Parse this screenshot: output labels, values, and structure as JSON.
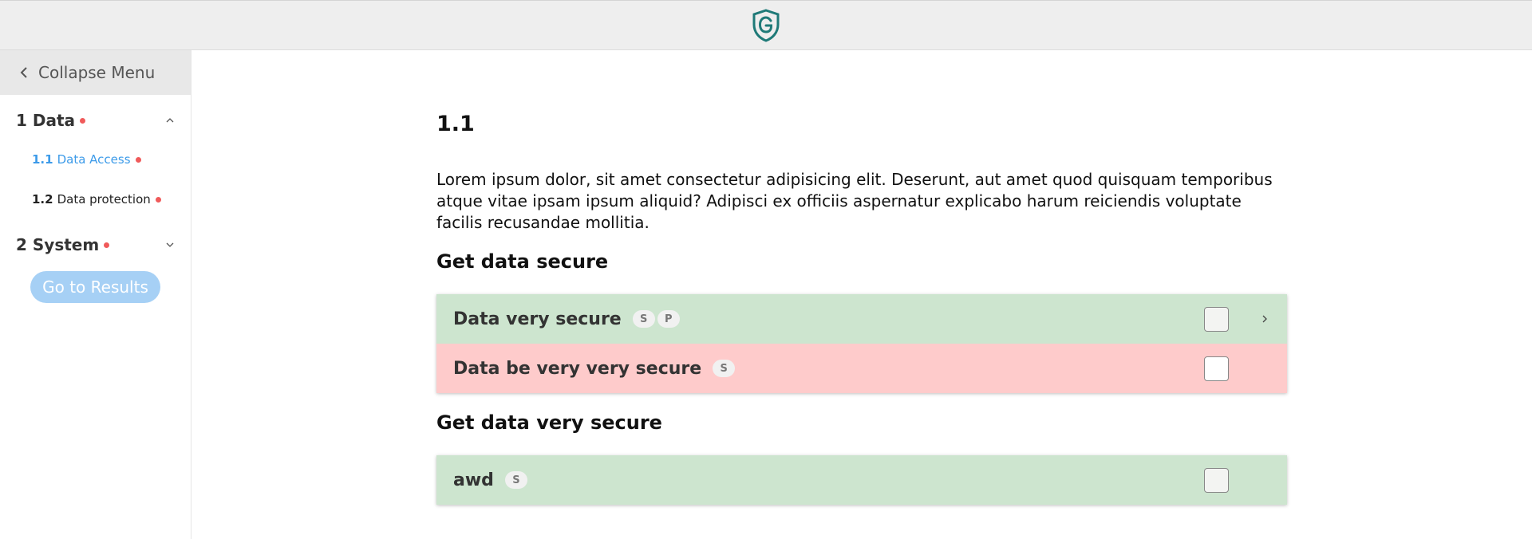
{
  "header": {
    "logo_icon": "shield-g-logo",
    "logo_color": "#1f7a78"
  },
  "sidebar": {
    "collapse_label": "Collapse Menu",
    "sections": [
      {
        "title": "1 Data",
        "expanded": true,
        "items": [
          {
            "num": "1.1",
            "label": "Data Access",
            "active": true
          },
          {
            "num": "1.2",
            "label": "Data protection",
            "active": false
          }
        ]
      },
      {
        "title": "2 System",
        "expanded": false,
        "items": []
      }
    ],
    "results_button": "Go to Results"
  },
  "main": {
    "title": "1.1",
    "intro": "Lorem ipsum dolor, sit amet consectetur adipisicing elit. Deserunt, aut amet quod quisquam temporibus atque vitae ipsam ipsum aliquid? Adipisci ex officiis aspernatur explicabo harum reiciendis voluptate facilis recusandae mollitia.",
    "groups": [
      {
        "title": "Get data secure",
        "rows": [
          {
            "title": "Data very secure",
            "badges": [
              "S",
              "P"
            ],
            "status": "green",
            "has_arrow": true
          },
          {
            "title": "Data be very very secure",
            "badges": [
              "S"
            ],
            "status": "red",
            "has_arrow": false
          }
        ]
      },
      {
        "title": "Get data very secure",
        "rows": [
          {
            "title": "awd",
            "badges": [
              "S"
            ],
            "status": "green",
            "has_arrow": false
          }
        ]
      }
    ]
  },
  "colors": {
    "green_row": "#cde5cf",
    "red_row": "#fecbcb",
    "accent": "#3d9be9",
    "alert_dot": "#f05a5a",
    "button": "#a6d0f5"
  }
}
